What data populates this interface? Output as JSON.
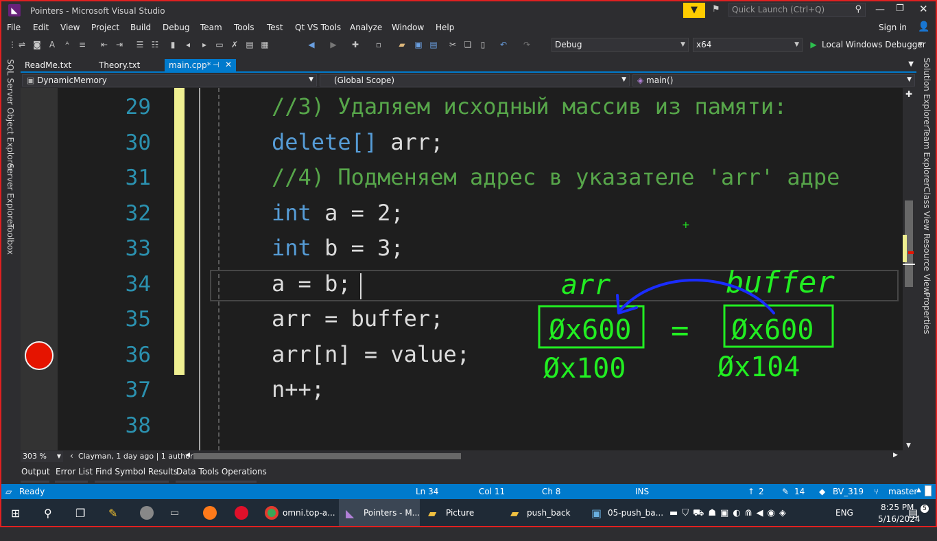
{
  "window": {
    "title": "Pointers - Microsoft Visual Studio",
    "quick_launch": "Quick Launch (Ctrl+Q)",
    "sign_in": "Sign in"
  },
  "menu": [
    "File",
    "Edit",
    "View",
    "Project",
    "Build",
    "Debug",
    "Team",
    "Tools",
    "Test",
    "Qt VS Tools",
    "Analyze",
    "Window",
    "Help"
  ],
  "toolbar": {
    "config": "Debug",
    "platform": "x64",
    "run_label": "Local Windows Debugger"
  },
  "tabs": [
    {
      "label": "ReadMe.txt",
      "active": false
    },
    {
      "label": "Theory.txt",
      "active": false
    },
    {
      "label": "main.cpp*",
      "active": true
    }
  ],
  "navbar": {
    "project": "DynamicMemory",
    "scope": "(Global Scope)",
    "member": "main()"
  },
  "left_panels": [
    "SQL Server Object Explorer",
    "Server Explorer",
    "Toolbox"
  ],
  "right_panels": [
    "Solution Explorer",
    "Team Explorer",
    "Class View",
    "Resource View",
    "Properties"
  ],
  "code": {
    "lines": [
      {
        "num": "29",
        "text": "//3) Удаляем исходный массив из памяти:"
      },
      {
        "num": "30",
        "text": "delete[] arr;"
      },
      {
        "num": "31",
        "text": "//4) Подменяем адрес в указателе 'arr' адре"
      },
      {
        "num": "32",
        "text": "int a = 2;"
      },
      {
        "num": "33",
        "text": "int b = 3;"
      },
      {
        "num": "34",
        "text": "a = b;"
      },
      {
        "num": "35",
        "text": "arr = buffer;"
      },
      {
        "num": "36",
        "text": "arr[n] = value;"
      },
      {
        "num": "37",
        "text": "n++;"
      },
      {
        "num": "38",
        "text": ""
      }
    ],
    "breakpoint_line": "36",
    "current_line": "34"
  },
  "editor_footer": {
    "zoom": "303 %",
    "codelens": "Clayman, 1 day ago | 1 author,"
  },
  "output_tabs": [
    "Output",
    "Error List",
    "Find Symbol Results",
    "Data Tools Operations"
  ],
  "status": {
    "ready": "Ready",
    "ln": "Ln 34",
    "col": "Col 11",
    "ch": "Ch 8",
    "mode": "INS",
    "up": "2",
    "edits": "14",
    "repo": "BV_319",
    "branch": "master"
  },
  "annotation": {
    "left_label": "arr",
    "right_label": "buffer",
    "left_addr": "Øx600",
    "right_addr": "Øx600",
    "equals": "=",
    "left_below": "Øx100",
    "right_below": "Øx104"
  },
  "taskbar": {
    "apps": [
      "omni.top-a...",
      "Pointers - M...",
      "Picture",
      "push_back",
      "05-push_ba..."
    ],
    "lang": "ENG",
    "time": "8:25 PM",
    "date": "5/16/2024",
    "notifications": "5"
  },
  "colors": {
    "accent": "#007acc",
    "comment": "#57a64a",
    "keyword": "#569cd6",
    "linenum": "#2b91af",
    "ink_green": "#22ee22",
    "ink_blue": "#1a2cff"
  }
}
